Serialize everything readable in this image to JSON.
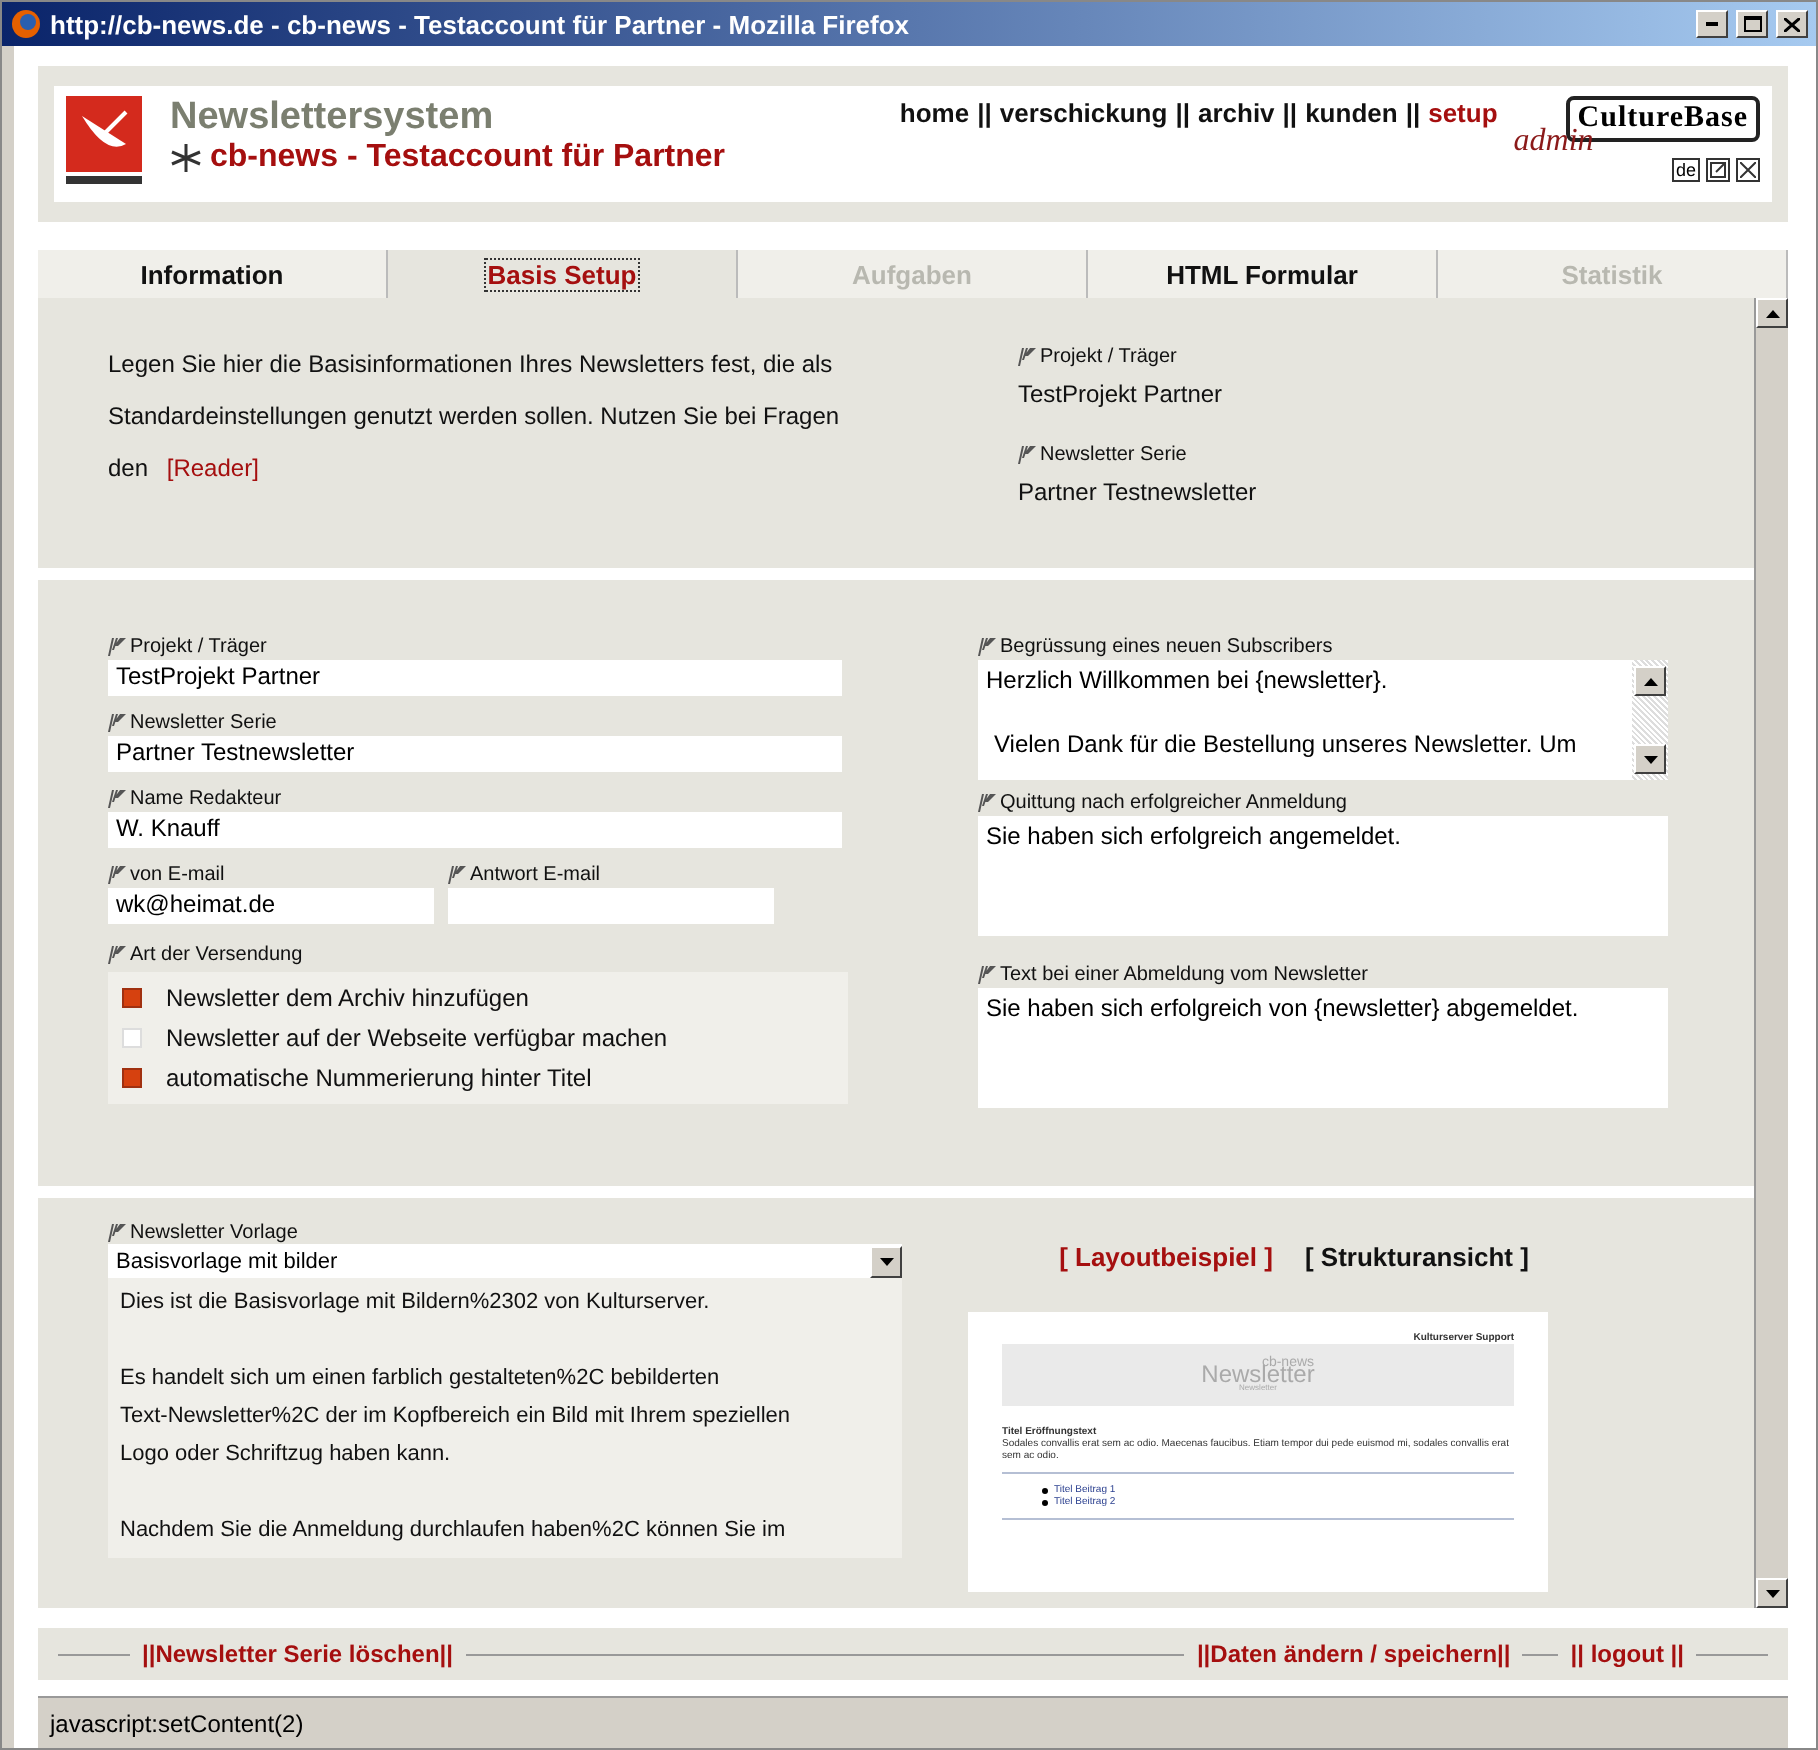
{
  "window": {
    "title": "http://cb-news.de - cb-news - Testaccount für Partner - Mozilla Firefox"
  },
  "header": {
    "title": "Newslettersystem",
    "subtitle": "cb-news - Testaccount für Partner",
    "logo_text": "CultureBase",
    "logo_sub": "admin",
    "language": "de",
    "separator": "||",
    "nav": [
      {
        "label": "home",
        "selected": false
      },
      {
        "label": "verschickung",
        "selected": false
      },
      {
        "label": "archiv",
        "selected": false
      },
      {
        "label": "kunden",
        "selected": false
      },
      {
        "label": "setup",
        "selected": true
      }
    ]
  },
  "tabs": [
    {
      "label": "Information",
      "selected": false,
      "disabled": false
    },
    {
      "label": "Basis Setup",
      "selected": true,
      "disabled": false
    },
    {
      "label": "Aufgaben",
      "selected": false,
      "disabled": true
    },
    {
      "label": "HTML Formular",
      "selected": false,
      "disabled": false
    },
    {
      "label": "Statistik",
      "selected": false,
      "disabled": true
    }
  ],
  "intro": {
    "text": "Legen Sie hier die Basisinformationen Ihres Newsletters fest, die als Standardeinstellungen genutzt werden sollen. Nutzen Sie bei Fragen den",
    "link": "[Reader]",
    "summary": [
      {
        "label": "Projekt / Träger",
        "value": "TestProjekt Partner"
      },
      {
        "label": "Newsletter Serie",
        "value": "Partner Testnewsletter"
      }
    ]
  },
  "form": {
    "fields": [
      {
        "label": "Projekt / Träger",
        "value": "TestProjekt Partner"
      },
      {
        "label": "Newsletter Serie",
        "value": "Partner Testnewsletter"
      },
      {
        "label": "Name Redakteur",
        "value": "W. Knauff"
      }
    ],
    "email_fields": [
      {
        "label": "von E-mail",
        "value": "wk@heimat.de"
      },
      {
        "label": "Antwort E-mail"
      }
    ],
    "delivery": {
      "label": "Art der Versendung",
      "options": [
        {
          "label": "Newsletter dem Archiv hinzufügen",
          "checked": true
        },
        {
          "label": "Newsletter auf der Webseite verfügbar machen",
          "checked": false
        },
        {
          "label": "automatische Nummerierung hinter Titel",
          "checked": true
        }
      ]
    },
    "messages": [
      {
        "label": "Begrüssung eines neuen Subscribers",
        "lines": [
          "Herzlich Willkommen bei {newsletter}.",
          "Vielen Dank für die Bestellung unseres Newsletter. Um"
        ],
        "scrollable": true
      },
      {
        "label": "Quittung nach erfolgreicher Anmeldung",
        "lines": [
          "Sie haben sich erfolgreich angemeldet."
        ],
        "scrollable": false
      },
      {
        "label": "Text bei einer Abmeldung vom Newsletter",
        "lines": [
          "Sie haben sich erfolgreich von {newsletter} abgemeldet."
        ],
        "scrollable": false
      }
    ]
  },
  "template": {
    "label": "Newsletter Vorlage",
    "value": "Basisvorlage mit bilder",
    "description": [
      [
        "Dies ist die Basisvorlage mit Bildern%2302 von Kulturserver."
      ],
      [
        "Es handelt sich um einen farblich gestalteten%2C bebilderten",
        "Text-Newsletter%2C der im Kopfbereich ein Bild mit Ihrem speziellen",
        "Logo oder Schriftzug haben kann."
      ],
      [
        "Nachdem Sie die Anmeldung durchlaufen haben%2C können Sie im"
      ]
    ],
    "views": [
      {
        "label": "[ Layoutbeispiel ]",
        "selected": true
      },
      {
        "label": "[ Strukturansicht ]",
        "selected": false
      }
    ],
    "preview": {
      "support": "Kulturserver Support",
      "banner_big": "Newsletter",
      "banner_name": "cb-news",
      "banner_small": "Newsletter",
      "heading": "Titel Eröffnungstext",
      "body": "Sodales convallis erat sem ac odio. Maecenas faucibus. Etiam tempor dui pede euismod mi, sodales convallis erat sem ac odio.",
      "items": [
        "Titel Beitrag 1",
        "Titel Beitrag 2"
      ]
    }
  },
  "actions": {
    "delete": "||Newsletter Serie löschen||",
    "save": "||Daten ändern / speichern||",
    "logout": "||  logout  ||"
  },
  "status_bar": "javascript:setContent(2)"
}
